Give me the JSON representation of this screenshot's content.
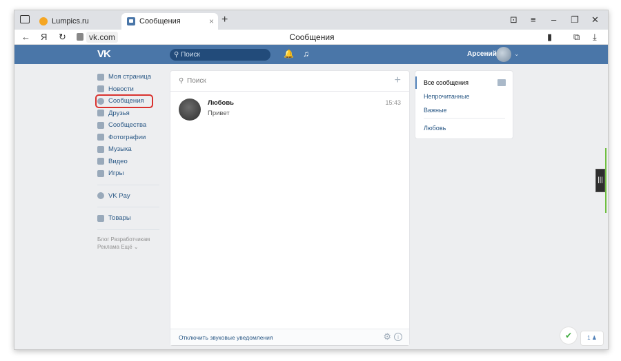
{
  "browser": {
    "tabs": [
      {
        "label": "Lumpics.ru"
      },
      {
        "label": "Сообщения"
      }
    ],
    "new_tab": "+",
    "tab_close": "×",
    "controls": [
      "⊡",
      "≡",
      "–",
      "❐",
      "✕"
    ],
    "nav": {
      "back": "←",
      "yandex": "Я",
      "reload": "↻"
    },
    "domain": "vk.com",
    "page_title": "Сообщения",
    "addr_right": [
      "▮",
      "⧉",
      "⤓"
    ]
  },
  "vk_header": {
    "logo": "VK",
    "search_placeholder": "Поиск",
    "bell_icon": "🔔",
    "music_icon": "♫",
    "username": "Арсений",
    "chevron": "⌄"
  },
  "left_menu": {
    "items": [
      {
        "label": "Моя страница"
      },
      {
        "label": "Новости"
      },
      {
        "label": "Сообщения"
      },
      {
        "label": "Друзья"
      },
      {
        "label": "Сообщества"
      },
      {
        "label": "Фотографии"
      },
      {
        "label": "Музыка"
      },
      {
        "label": "Видео"
      },
      {
        "label": "Игры"
      }
    ],
    "vkpay": "VK Pay",
    "goods": "Товары",
    "footer_line1": "Блог  Разработчикам",
    "footer_line2": "Реклама  Ещё ⌄"
  },
  "dialogs": {
    "search_placeholder": "Поиск",
    "search_icon": "⚲",
    "add_icon": "+",
    "items": [
      {
        "name": "Любовь",
        "message": "Привет",
        "time": "15:43"
      }
    ],
    "footer_mute": "Отключить звуковые уведомления",
    "gear_icon": "⚙",
    "info_icon": "i"
  },
  "filters": {
    "all": "Все сообщения",
    "unread": "Непрочитанные",
    "important": "Важные",
    "contact": "Любовь"
  },
  "misc": {
    "shield": "✔",
    "online_count": "1 ♟",
    "grip": "|||"
  },
  "colors": {
    "vk_blue": "#4a76a8",
    "link": "#2a5885",
    "highlight": "#d9312e"
  }
}
